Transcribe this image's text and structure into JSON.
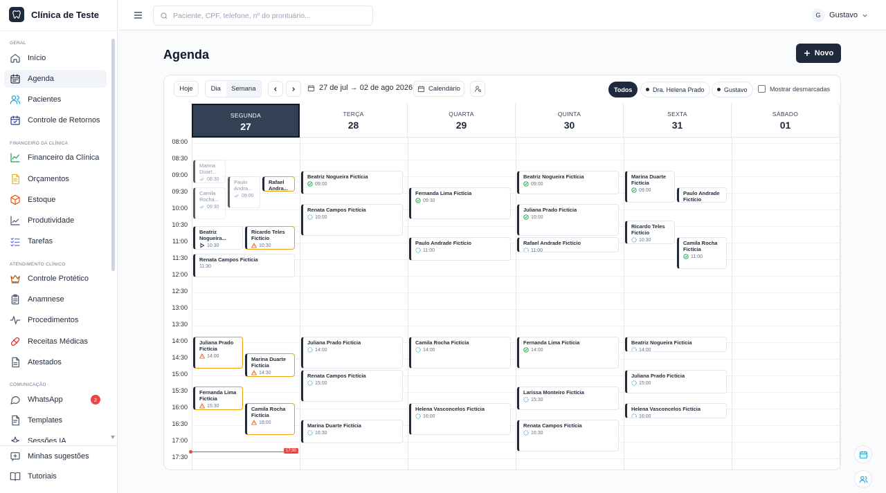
{
  "brand": {
    "name": "Clínica de Teste"
  },
  "sidebar": {
    "sections": [
      "Geral",
      "Financeiro da Clínica",
      "Atendimento Clínico",
      "Comunicação"
    ],
    "items": [
      {
        "label": "Início",
        "icon": "home-icon"
      },
      {
        "label": "Agenda",
        "icon": "calendar-icon",
        "active": true
      },
      {
        "label": "Pacientes",
        "icon": "users-icon"
      },
      {
        "label": "Controle de Retornos",
        "icon": "calendar-check-icon"
      },
      {
        "label": "Financeiro da Clínica",
        "icon": "chart-line-icon"
      },
      {
        "label": "Orçamentos",
        "icon": "document-icon"
      },
      {
        "label": "Estoque",
        "icon": "box-icon"
      },
      {
        "label": "Produtividade",
        "icon": "trend-icon"
      },
      {
        "label": "Tarefas",
        "icon": "checklist-icon"
      },
      {
        "label": "Controle Protético",
        "icon": "crown-icon"
      },
      {
        "label": "Anamnese",
        "icon": "clipboard-icon"
      },
      {
        "label": "Procedimentos",
        "icon": "pulse-icon"
      },
      {
        "label": "Receitas Médicas",
        "icon": "pill-icon"
      },
      {
        "label": "Atestados",
        "icon": "file-text-icon"
      },
      {
        "label": "WhatsApp",
        "icon": "chat-icon",
        "badge": "2"
      },
      {
        "label": "Templates",
        "icon": "template-icon"
      },
      {
        "label": "Sessões IA",
        "icon": "sparkle-icon"
      }
    ],
    "bottom": [
      {
        "label": "Minhas sugestões",
        "icon": "suggestion-icon"
      },
      {
        "label": "Tutoriais",
        "icon": "book-icon"
      }
    ]
  },
  "topbar": {
    "search_placeholder": "Paciente, CPF, telefone, nº do prontuário...",
    "user_initial": "G",
    "user_name": "Gustavo"
  },
  "page": {
    "title": "Agenda",
    "new_label": "Novo"
  },
  "toolbar": {
    "today": "Hoje",
    "view_day": "Dia",
    "view_week": "Semana",
    "range": "27 de jul → 02 de ago 2026",
    "calendar": "Calendário",
    "filters": [
      "Todos",
      "Dra. Helena Prado",
      "Gustavo"
    ],
    "show_unmarked": "Mostrar desmarcadas"
  },
  "days": [
    {
      "name": "SEGUNDA",
      "date": "27",
      "today": true
    },
    {
      "name": "TERÇA",
      "date": "28"
    },
    {
      "name": "QUARTA",
      "date": "29"
    },
    {
      "name": "QUINTA",
      "date": "30"
    },
    {
      "name": "SEXTA",
      "date": "31"
    },
    {
      "name": "SÁBADO",
      "date": "01"
    }
  ],
  "hours": [
    "08:00",
    "08:30",
    "09:00",
    "09:30",
    "10:00",
    "10:30",
    "11:00",
    "11:30",
    "12:00",
    "12:30",
    "13:00",
    "13:30",
    "14:00",
    "14:30",
    "15:00",
    "15:30",
    "16:00",
    "16:30",
    "17:00",
    "17:30"
  ],
  "now": "17:30",
  "events": [
    {
      "day": 0,
      "start": "08:30",
      "end": "09:15",
      "lane": 0,
      "lanes": 3,
      "name": "Marina Duart...",
      "time": "08:30",
      "status": "faded"
    },
    {
      "day": 0,
      "start": "09:00",
      "end": "10:00",
      "lane": 1,
      "lanes": 3,
      "name": "Paulo Andra...",
      "time": "09:00",
      "status": "faded"
    },
    {
      "day": 0,
      "start": "09:00",
      "end": "09:30",
      "lane": 2,
      "lanes": 3,
      "name": "Rafael Andra...",
      "time": "",
      "status": "warn"
    },
    {
      "day": 0,
      "start": "09:20",
      "end": "10:20",
      "lane": 0,
      "lanes": 3,
      "name": "Camila Rocha...",
      "time": "09:30",
      "status": "faded"
    },
    {
      "day": 0,
      "start": "10:30",
      "end": "11:15",
      "lane": 0,
      "lanes": 2,
      "name": "Beatriz Nogueira...",
      "time": "10:30",
      "status": "play"
    },
    {
      "day": 0,
      "start": "10:30",
      "end": "11:15",
      "lane": 1,
      "lanes": 2,
      "name": "Ricardo Teles Fictício",
      "time": "10:30",
      "status": "warn"
    },
    {
      "day": 0,
      "start": "11:20",
      "end": "12:05",
      "lane": 0,
      "lanes": 1,
      "name": "Renata Campos Fictícia",
      "time": "11:30",
      "status": "plain"
    },
    {
      "day": 0,
      "start": "13:50",
      "end": "14:50",
      "lane": 0,
      "lanes": 2,
      "name": "Juliana Prado Fictícia",
      "time": "14:00",
      "status": "warn"
    },
    {
      "day": 0,
      "start": "14:20",
      "end": "15:05",
      "lane": 1,
      "lanes": 2,
      "name": "Marina Duarte Fictícia",
      "time": "14:30",
      "status": "warn"
    },
    {
      "day": 0,
      "start": "15:20",
      "end": "16:05",
      "lane": 0,
      "lanes": 2,
      "name": "Fernanda Lima Fictícia",
      "time": "15:30",
      "status": "warn"
    },
    {
      "day": 0,
      "start": "15:50",
      "end": "16:50",
      "lane": 1,
      "lanes": 2,
      "name": "Camila Rocha Fictícia",
      "time": "16:00",
      "status": "warn"
    },
    {
      "day": 1,
      "start": "08:50",
      "end": "09:35",
      "lane": 0,
      "lanes": 1,
      "name": "Beatriz Nogueira Fictícia",
      "time": "09:00",
      "status": "check"
    },
    {
      "day": 1,
      "start": "09:50",
      "end": "10:50",
      "lane": 0,
      "lanes": 1,
      "name": "Renata Campos Fictícia",
      "time": "10:00",
      "status": "dashed"
    },
    {
      "day": 1,
      "start": "13:50",
      "end": "14:50",
      "lane": 0,
      "lanes": 1,
      "name": "Juliana Prado Fictícia",
      "time": "14:00",
      "status": "dashed"
    },
    {
      "day": 1,
      "start": "14:50",
      "end": "15:50",
      "lane": 0,
      "lanes": 1,
      "name": "Renata Campos Fictícia",
      "time": "15:00",
      "status": "dashed"
    },
    {
      "day": 1,
      "start": "16:20",
      "end": "17:05",
      "lane": 0,
      "lanes": 1,
      "name": "Marina Duarte Fictícia",
      "time": "16:30",
      "status": "dashed"
    },
    {
      "day": 2,
      "start": "09:20",
      "end": "10:20",
      "lane": 0,
      "lanes": 1,
      "name": "Fernanda Lima Fictícia",
      "time": "09:30",
      "status": "check"
    },
    {
      "day": 2,
      "start": "10:50",
      "end": "11:35",
      "lane": 0,
      "lanes": 1,
      "name": "Paulo Andrade Fictício",
      "time": "11:00",
      "status": "dashed"
    },
    {
      "day": 2,
      "start": "13:50",
      "end": "14:50",
      "lane": 0,
      "lanes": 1,
      "name": "Camila Rocha Fictícia",
      "time": "14:00",
      "status": "dashed"
    },
    {
      "day": 2,
      "start": "15:50",
      "end": "16:50",
      "lane": 0,
      "lanes": 1,
      "name": "Helena Vasconcelos Fictícia",
      "time": "16:00",
      "status": "dashed"
    },
    {
      "day": 3,
      "start": "08:50",
      "end": "09:35",
      "lane": 0,
      "lanes": 1,
      "name": "Beatriz Nogueira Fictícia",
      "time": "09:00",
      "status": "check"
    },
    {
      "day": 3,
      "start": "09:50",
      "end": "10:50",
      "lane": 0,
      "lanes": 1,
      "name": "Juliana Prado Fictícia",
      "time": "10:00",
      "status": "check"
    },
    {
      "day": 3,
      "start": "10:50",
      "end": "11:20",
      "lane": 0,
      "lanes": 1,
      "name": "Rafael Andrade Fictício",
      "time": "11:00",
      "status": "dashed"
    },
    {
      "day": 3,
      "start": "13:50",
      "end": "14:50",
      "lane": 0,
      "lanes": 1,
      "name": "Fernanda Lima Fictícia",
      "time": "14:00",
      "status": "check"
    },
    {
      "day": 3,
      "start": "15:20",
      "end": "16:05",
      "lane": 0,
      "lanes": 1,
      "name": "Larissa Monteiro Fictícia",
      "time": "15:30",
      "status": "dashed"
    },
    {
      "day": 3,
      "start": "16:20",
      "end": "17:20",
      "lane": 0,
      "lanes": 1,
      "name": "Renata Campos Fictícia",
      "time": "16:30",
      "status": "dashed"
    },
    {
      "day": 4,
      "start": "08:50",
      "end": "09:50",
      "lane": 0,
      "lanes": 2,
      "name": "Marina Duarte Fictícia",
      "time": "09:00",
      "status": "check"
    },
    {
      "day": 4,
      "start": "09:20",
      "end": "09:50",
      "lane": 1,
      "lanes": 2,
      "name": "Paulo Andrade Fictício",
      "time": "",
      "status": "plain"
    },
    {
      "day": 4,
      "start": "10:20",
      "end": "11:05",
      "lane": 0,
      "lanes": 2,
      "name": "Ricardo Teles Fictício",
      "time": "10:30",
      "status": "dashed"
    },
    {
      "day": 4,
      "start": "10:50",
      "end": "11:50",
      "lane": 1,
      "lanes": 2,
      "name": "Camila Rocha Fictícia",
      "time": "11:00",
      "status": "check"
    },
    {
      "day": 4,
      "start": "13:50",
      "end": "14:20",
      "lane": 0,
      "lanes": 1,
      "name": "Beatriz Nogueira Fictícia",
      "time": "14:00",
      "status": "dashed"
    },
    {
      "day": 4,
      "start": "14:50",
      "end": "15:35",
      "lane": 0,
      "lanes": 1,
      "name": "Juliana Prado Fictícia",
      "time": "15:00",
      "status": "dashed"
    },
    {
      "day": 4,
      "start": "15:50",
      "end": "16:20",
      "lane": 0,
      "lanes": 1,
      "name": "Helena Vasconcelos Fictícia",
      "time": "16:00",
      "status": "dashed"
    }
  ],
  "colors": {
    "accent": "#1e293b",
    "warn": "#f59e0b",
    "check": "#16a34a",
    "dashed": "#0ea5e9",
    "now": "#ef4444"
  }
}
